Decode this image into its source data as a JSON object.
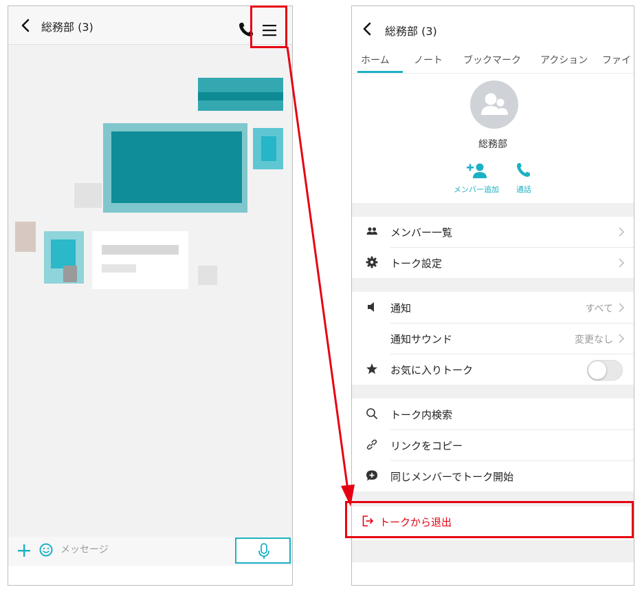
{
  "left_screen": {
    "title": "総務部 (3)",
    "message_placeholder": "メッセージ"
  },
  "right_screen": {
    "title": "総務部 (3)",
    "tabs": [
      {
        "label": "ホーム"
      },
      {
        "label": "ノート"
      },
      {
        "label": "ブックマーク"
      },
      {
        "label": "アクション"
      },
      {
        "label": "ファイ"
      }
    ],
    "group_name": "総務部",
    "actions": {
      "add_member": "メンバー追加",
      "call": "通話"
    },
    "menu": {
      "member_list": "メンバー一覧",
      "talk_settings": "トーク設定",
      "notification": "通知",
      "notification_value": "すべて",
      "notification_sound": "通知サウンド",
      "notification_sound_value": "変更なし",
      "favorite_talk": "お気に入りトーク",
      "favorite_talk_on": false,
      "search_in_talk": "トーク内検索",
      "copy_link": "リンクをコピー",
      "start_talk_same_members": "同じメンバーでトーク開始",
      "leave_talk": "トークから退出"
    }
  },
  "colors": {
    "accent": "#1bb1c4",
    "highlight": "#e60012",
    "chat_bubble": "#0f8d98"
  }
}
